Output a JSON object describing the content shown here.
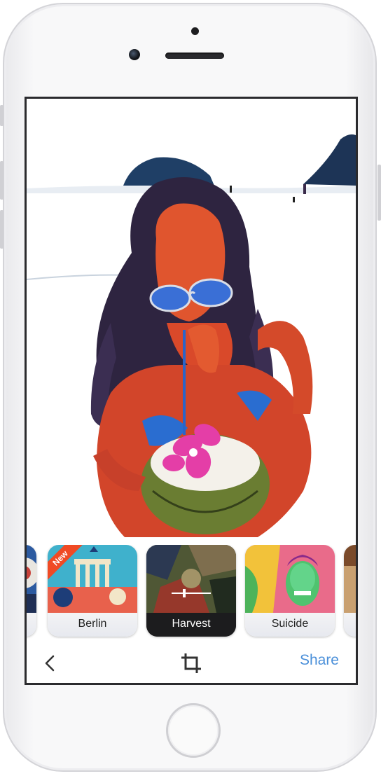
{
  "filters": {
    "items": [
      {
        "label": "Berlin",
        "badge": "New",
        "selected": false
      },
      {
        "label": "Harvest",
        "selected": true
      },
      {
        "label": "Suicide",
        "selected": false
      }
    ]
  },
  "toolbar": {
    "back_icon": "chevron-left-icon",
    "crop_icon": "crop-icon",
    "share_label": "Share"
  },
  "colors": {
    "accent": "#4a8fd9",
    "badge": "#f04a24",
    "selected_label_bg": "#1c1c1e"
  }
}
